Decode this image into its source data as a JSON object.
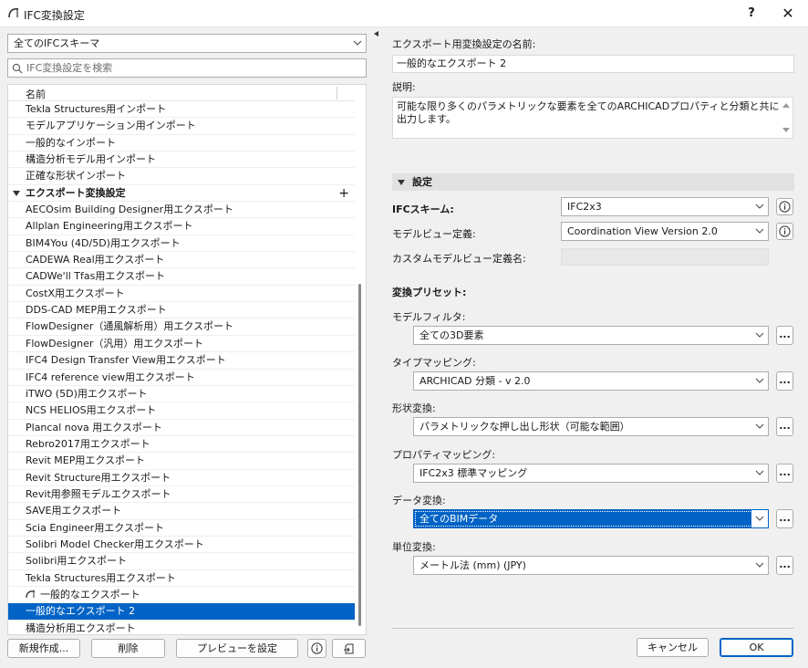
{
  "window": {
    "title": "IFC変換設定",
    "help": "?",
    "close": "✕"
  },
  "left": {
    "schema_filter": "全てのIFCスキーマ",
    "search_placeholder": "IFC変換設定を検索",
    "column_header": "名前",
    "rows_top": [
      "Tekla Structures用インポート",
      "モデルアプリケーション用インポート",
      "一般的なインポート",
      "構造分析モデル用インポート",
      "正確な形状インポート"
    ],
    "export_group": "エクスポート変換設定",
    "export_group_add": "+",
    "rows_export": [
      "AECOsim Building Designer用エクスポート",
      "Allplan Engineering用エクスポート",
      "BIM4You (4D/5D)用エクスポート",
      "CADEWA Real用エクスポート",
      "CADWe'll Tfas用エクスポート",
      "CostX用エクスポート",
      "DDS-CAD MEP用エクスポート",
      "FlowDesigner（通風解析用）用エクスポート",
      "FlowDesigner（汎用）用エクスポート",
      "IFC4 Design Transfer View用エクスポート",
      "IFC4 reference view用エクスポート",
      "iTWO (5D)用エクスポート",
      "NCS HELIOS用エクスポート",
      "Plancal nova 用エクスポート",
      "Rebro2017用エクスポート",
      "Revit MEP用エクスポート",
      "Revit Structure用エクスポート",
      "Revit用参照モデルエクスポート",
      "SAVE用エクスポート",
      "Scia Engineer用エクスポート",
      "Solibri Model Checker用エクスポート",
      "Solibri用エクスポート",
      "Tekla Structures用エクスポート"
    ],
    "row_general_export": "一般的なエクスポート",
    "row_selected": "一般的なエクスポート 2",
    "row_last": "構造分析用エクスポート",
    "buttons": {
      "new": "新規作成...",
      "delete": "削除",
      "preview": "プレビューを設定"
    }
  },
  "right": {
    "name_label": "エクスポート用変換設定の名前:",
    "name_value": "一般的なエクスポート 2",
    "desc_label": "説明:",
    "desc_value": "可能な限り多くのパラメトリックな要素を全てのARCHICADプロパティと分類と共に出力します。",
    "settings_section": "設定",
    "ifc_scheme_label": "IFCスキーム:",
    "ifc_scheme_value": "IFC2x3",
    "model_view_label": "モデルビュー定義:",
    "model_view_value": "Coordination View Version 2.0",
    "custom_mvd_label": "カスタムモデルビュー定義名:",
    "presets_label": "変換プリセット:",
    "model_filter_label": "モデルフィルタ:",
    "model_filter_value": "全ての3D要素",
    "type_mapping_label": "タイプマッピング:",
    "type_mapping_value": "ARCHICAD 分類 - v 2.0",
    "geometry_label": "形状変換:",
    "geometry_value": "パラメトリックな押し出し形状（可能な範囲）",
    "property_label": "プロパティマッピング:",
    "property_value": "IFC2x3 標準マッピング",
    "data_label": "データ変換:",
    "data_value": "全てのBIMデータ",
    "unit_label": "単位変換:",
    "unit_value": "メートル法 (mm) (JPY)",
    "dots": "...",
    "cancel": "キャンセル",
    "ok": "OK"
  },
  "colors": {
    "selection": "#0063c5",
    "section_bg": "#e1e1e1",
    "window_bg": "#f0f0f0"
  }
}
